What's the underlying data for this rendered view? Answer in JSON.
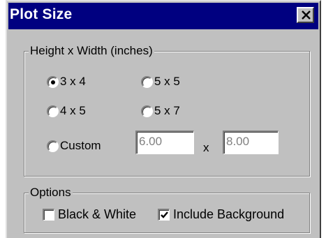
{
  "window": {
    "title": "Plot Size",
    "close_glyph": "close-icon"
  },
  "size_group": {
    "legend": "Height x Width (inches)",
    "options": [
      {
        "label": "3 x 4",
        "selected": true
      },
      {
        "label": "5 x 5",
        "selected": false
      },
      {
        "label": "4 x 5",
        "selected": false
      },
      {
        "label": "5 x 7",
        "selected": false
      },
      {
        "label": "Custom",
        "selected": false
      }
    ],
    "custom": {
      "height_value": "6.00",
      "separator": "x",
      "width_value": "8.00",
      "enabled": false
    }
  },
  "options_group": {
    "legend": "Options",
    "black_white": {
      "label": "Black & White",
      "checked": false
    },
    "include_background": {
      "label": "Include Background",
      "checked": true
    }
  },
  "colors": {
    "titlebar": "#000080",
    "face": "#c0c0c0",
    "disabled_text": "#808080"
  }
}
